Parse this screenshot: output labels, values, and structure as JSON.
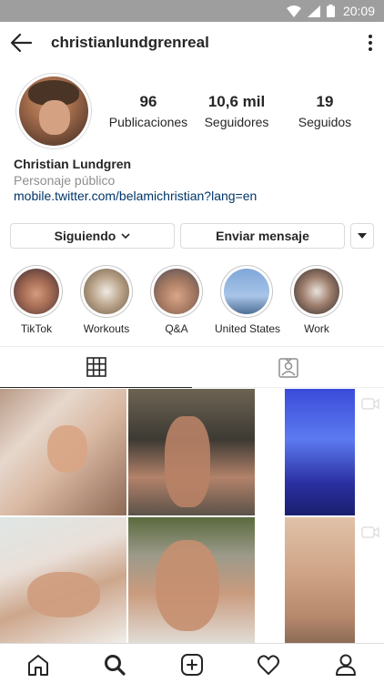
{
  "status_bar": {
    "time": "20:09"
  },
  "header": {
    "username": "christianlundgrenreal"
  },
  "profile": {
    "stats": [
      {
        "value": "96",
        "label": "Publicaciones"
      },
      {
        "value": "10,6 mil",
        "label": "Seguidores"
      },
      {
        "value": "19",
        "label": "Seguidos"
      }
    ],
    "name": "Christian Lundgren",
    "category": "Personaje público",
    "link": "mobile.twitter.com/belamichristian?lang=en"
  },
  "actions": {
    "following_label": "Siguiendo",
    "message_label": "Enviar mensaje"
  },
  "highlights": [
    {
      "label": "TikTok"
    },
    {
      "label": "Workouts"
    },
    {
      "label": "Q&A"
    },
    {
      "label": "United States"
    },
    {
      "label": "Work"
    }
  ],
  "tabs": [
    {
      "icon": "grid-icon",
      "active": true
    },
    {
      "icon": "tagged-icon",
      "active": false
    }
  ],
  "colors": {
    "link": "#003569",
    "secondary_text": "#8e8e8e",
    "border": "#dbdbdb"
  },
  "bottom_nav": [
    {
      "icon": "home-icon"
    },
    {
      "icon": "search-icon",
      "active": true
    },
    {
      "icon": "add-post-icon"
    },
    {
      "icon": "heart-icon"
    },
    {
      "icon": "profile-icon"
    }
  ]
}
